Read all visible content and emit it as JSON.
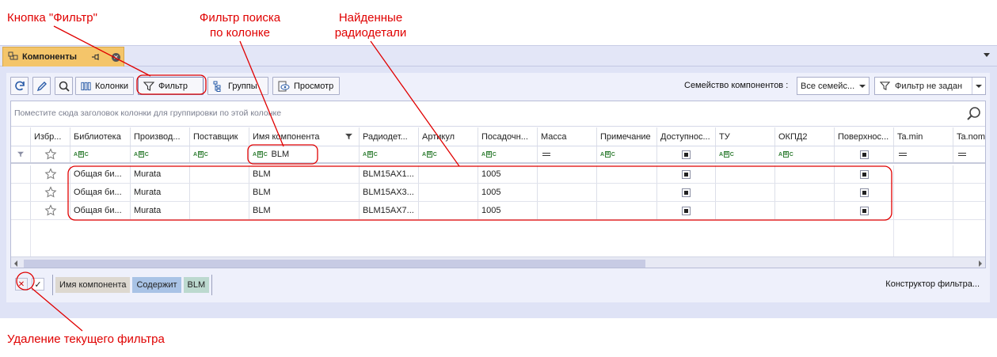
{
  "annotations": {
    "filter_button_note": "Кнопка \"Фильтр\"",
    "column_filter_note_1": "Фильтр поиска",
    "column_filter_note_2": "по колонке",
    "found_parts_note_1": "Найденные",
    "found_parts_note_2": "радиодетали",
    "remove_filter_note": "Удаление текущего фильтра"
  },
  "doc_tab": {
    "title": "Компоненты"
  },
  "toolbar": {
    "columns_label": "Колонки",
    "filter_label": "Фильтр",
    "groups_label": "Группы",
    "preview_label": "Просмотр",
    "family_label": "Семейство компонентов :",
    "family_value": "Все семейс...",
    "filter_status": "Фильтр не задан"
  },
  "grid": {
    "group_hint": "Поместите сюда заголовок колонки для группировки по этой колонке",
    "columns": [
      "Избр...",
      "Библиотека",
      "Производ...",
      "Поставщик",
      "Имя компонента",
      "Радиодет...",
      "Артикул",
      "Посадочн...",
      "Масса",
      "Примечание",
      "Доступнос...",
      "ТУ",
      "ОКПД2",
      "Поверхнос...",
      "Ta.min",
      "Ta.nom"
    ],
    "filter_row_value": "BLM",
    "rows": [
      {
        "library": "Общая би...",
        "manufacturer": "Murata",
        "name": "BLM",
        "part": "BLM15AX1...",
        "footprint": "1005"
      },
      {
        "library": "Общая би...",
        "manufacturer": "Murata",
        "name": "BLM",
        "part": "BLM15AX3...",
        "footprint": "1005"
      },
      {
        "library": "Общая би...",
        "manufacturer": "Murata",
        "name": "BLM",
        "part": "BLM15AX7...",
        "footprint": "1005"
      }
    ]
  },
  "filter_panel": {
    "field": "Имя компонента",
    "operator": "Содержит",
    "value": "BLM",
    "builder_label": "Конструктор фильтра..."
  },
  "colors": {
    "annotation": "#e00000",
    "tab_active": "#f4c56a",
    "panel_bg": "#dfe3f6"
  }
}
